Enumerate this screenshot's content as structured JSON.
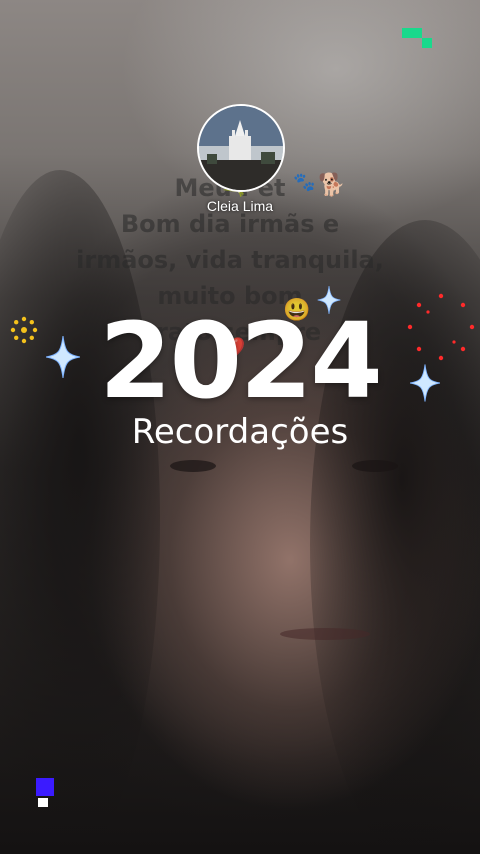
{
  "status": {
    "caption_lines": [
      "Meu Pet",
      "Bom dia irmãs e",
      "irmãos, vida tranquila,",
      "muito bom",
      "grato      sempre"
    ],
    "caption_emojis": [
      "💐",
      "🐾",
      "🐕",
      "😃",
      "❤️"
    ]
  },
  "profile": {
    "name": "Cleia Lima",
    "avatar_icon": "church-photo"
  },
  "overlay": {
    "year": "2024",
    "subtitle": "Recordações"
  },
  "decorations": {
    "sparkle_color": "#cfe8ff",
    "accent_green": "#19d98c",
    "accent_blue": "#3b1bff",
    "accent_red": "#ff2a2a",
    "accent_yellow": "#f4c21c"
  }
}
